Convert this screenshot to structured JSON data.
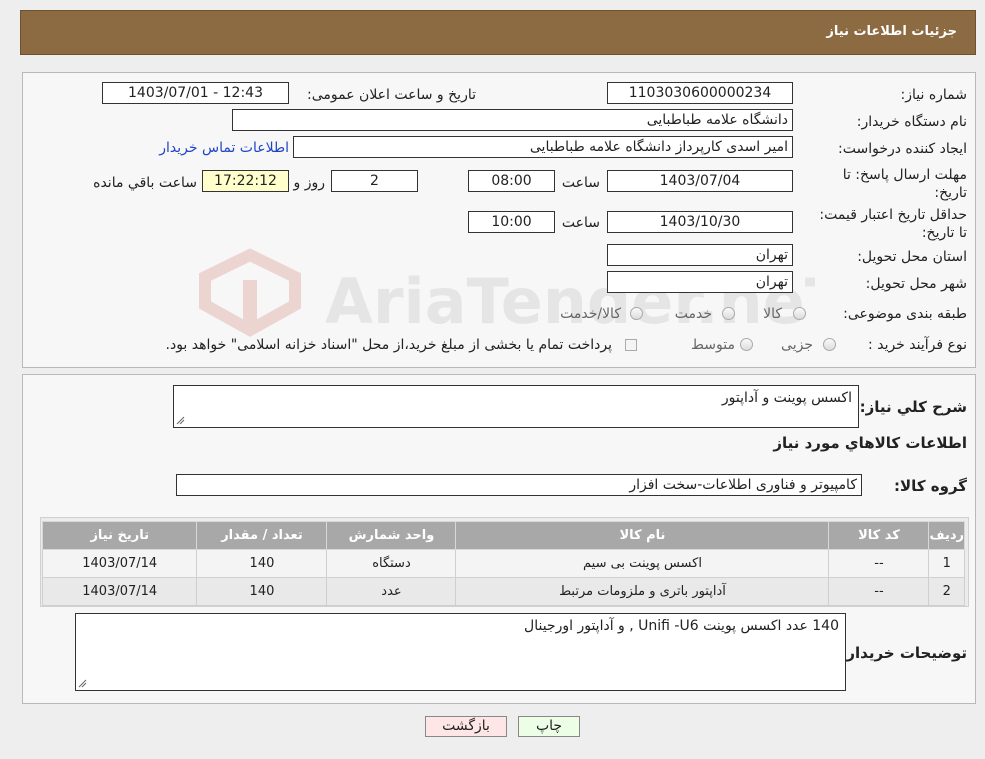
{
  "header": {
    "title": "جزئیات اطلاعات نیاز"
  },
  "form": {
    "need_number_label": "شماره نیاز:",
    "need_number": "1103030600000234",
    "announce_label": "تاریخ و ساعت اعلان عمومی:",
    "announce_value": "1403/07/01 - 12:43",
    "buyer_org_label": "نام دستگاه خریدار:",
    "buyer_org": "دانشگاه علامه طباطبایی",
    "creator_label": "ایجاد کننده درخواست:",
    "creator": "امیر اسدی کارپرداز دانشگاه علامه طباطبایی",
    "contact_link": "اطلاعات تماس خریدار",
    "reply_deadline_label": "مهلت ارسال پاسخ: تا تاریخ:",
    "reply_date": "1403/07/04",
    "time_label": "ساعت",
    "reply_time": "08:00",
    "days_value": "2",
    "days_label": "روز و",
    "remaining_time": "17:22:12",
    "remaining_label": "ساعت باقي مانده",
    "price_validity_label": "حداقل تاریخ اعتبار قیمت: تا تاریخ:",
    "price_date": "1403/10/30",
    "price_time": "10:00",
    "province_label": "استان محل تحویل:",
    "province": "تهران",
    "city_label": "شهر محل تحویل:",
    "city": "تهران",
    "category_label": "طبقه بندی موضوعی:",
    "category_options": [
      "کالا",
      "خدمت",
      "کالا/خدمت"
    ],
    "process_label": "نوع فرآیند خرید :",
    "process_options": [
      "جزیی",
      "متوسط"
    ],
    "payment_note": "پرداخت تمام یا بخشی از مبلغ خرید،از محل \"اسناد خزانه اسلامی\" خواهد بود."
  },
  "details": {
    "summary_label": "شرح کلي نياز:",
    "summary": "اکسس پوینت و آداپتور",
    "goods_info_title": "اطلاعات کالاهاي مورد نياز",
    "goods_group_label": "گروه کالا:",
    "goods_group": "کامپیوتر و فناوری اطلاعات-سخت افزار",
    "table": {
      "headers": [
        "ردیف",
        "کد کالا",
        "نام کالا",
        "واحد شمارش",
        "تعداد / مقدار",
        "تاریخ نیاز"
      ],
      "rows": [
        [
          "1",
          "--",
          "اکسس پوینت بی سیم",
          "دستگاه",
          "140",
          "1403/07/14"
        ],
        [
          "2",
          "--",
          "آداپتور باتری و ملزومات مرتبط",
          "عدد",
          "140",
          "1403/07/14"
        ]
      ]
    },
    "buyer_notes_label": "توضیحات خریدار:",
    "buyer_notes": "140 عدد اکسس پوینت Unifi -U6 , و آداپتور اورجینال"
  },
  "buttons": {
    "print": "چاپ",
    "back": "بازگشت"
  },
  "watermark": {
    "text": "AriaTender.neT"
  },
  "colors": {
    "header_bg": "#8c6b43",
    "print_bg": "#ecffe6",
    "back_bg": "#ffe6e6",
    "link": "#1f45c7"
  }
}
